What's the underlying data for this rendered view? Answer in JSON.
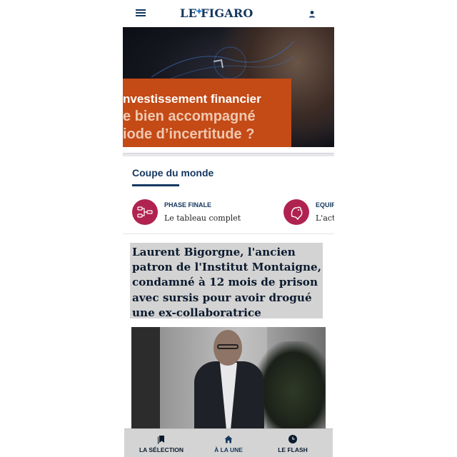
{
  "header": {
    "logo_text_left": "LE",
    "logo_text_right": "FIGARO",
    "menu_icon": "hamburger-menu-icon",
    "account_icon": "user-account-icon"
  },
  "banner": {
    "line1": "nvestissement financier",
    "line2": "e bien accompagné",
    "line3": "iode d’incertitude ?",
    "accent_color": "#c44a16"
  },
  "section": {
    "title": "Coupe du monde",
    "cards": [
      {
        "kicker": "PHASE FINALE",
        "text": "Le tableau complet",
        "icon": "bracket-icon"
      },
      {
        "kicker": "EQUIF",
        "text": "L'actu",
        "icon": "rooster-icon"
      }
    ]
  },
  "article": {
    "headline": "Laurent Bigorgne, l'ancien patron de l'Institut Montaigne, condamné à 12 mois de prison avec sursis pour avoir drogué une ex-collaboratrice"
  },
  "bottom_nav": {
    "items": [
      {
        "label": "LA SÉLECTION",
        "icon": "bookmark-icon",
        "active": false
      },
      {
        "label": "À LA UNE",
        "icon": "home-icon",
        "active": true
      },
      {
        "label": "LE FLASH",
        "icon": "clock-icon",
        "active": false
      }
    ]
  },
  "colors": {
    "brand": "#163860",
    "badge": "#b02350"
  }
}
